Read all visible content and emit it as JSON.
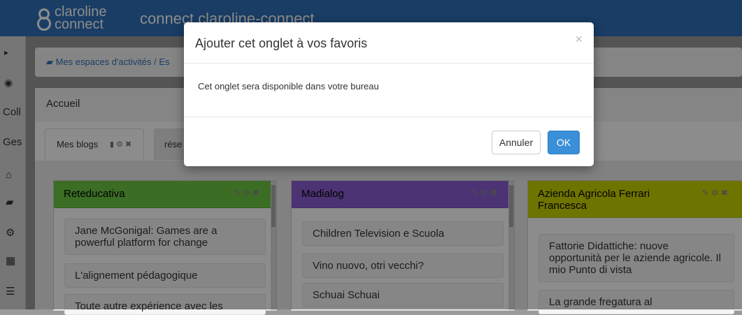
{
  "topbar": {
    "logo_line1": "claroline",
    "logo_line2": "connect",
    "title": "connect claroline-connect",
    "brand_color": "#2f6fb8"
  },
  "sidebar": {
    "items": [
      {
        "icon": "chevron-right-icon",
        "glyph": "▸"
      },
      {
        "icon": "eye-icon",
        "glyph": "◉"
      },
      {
        "label": "Coll"
      },
      {
        "label": "Ges"
      },
      {
        "icon": "home-icon",
        "glyph": "⌂"
      },
      {
        "icon": "folder-icon",
        "glyph": "▰"
      },
      {
        "icon": "cogs-icon",
        "glyph": "⚙"
      },
      {
        "icon": "calendar-icon",
        "glyph": "▦"
      },
      {
        "icon": "list-icon",
        "glyph": "☰"
      }
    ]
  },
  "breadcrumb": {
    "icon": "book-icon",
    "text": "Mes espaces d'activités / Es"
  },
  "panel": {
    "title": "Accueil"
  },
  "tabs": [
    {
      "label": "Mes blogs",
      "icons": "bookmark-icon gear-icon close-icon",
      "glyphs": "▮ ⚙ ✖"
    },
    {
      "label": "rése"
    }
  ],
  "widgets": [
    {
      "title": "Reteducativa",
      "color": "#6cc644",
      "border": "#5aa836",
      "items": [
        "Jane McGonigal: Games are a powerful platform for change",
        "L'alignement pédagogique",
        "Toute autre expérience avec les"
      ]
    },
    {
      "title": "Madialog",
      "color": "#8a5fd4",
      "border": "#7a4fc4",
      "items": [
        "Children Television e Scuola",
        "Vino nuovo, otri vecchi?",
        "Schuai Schuai"
      ]
    },
    {
      "title": "Azienda Agricola Ferrari Francesca",
      "color": "#c8d400",
      "border": "#b0bb00",
      "items": [
        "Fattorie Didattiche: nuove opportunità per le aziende agricole. Il mio Punto di vista",
        "La grande fregatura al"
      ]
    }
  ],
  "widget_icons": "✎ ⚙ ✖",
  "modal": {
    "title": "Ajouter cet onglet à vos favoris",
    "close": "×",
    "body": "Cet onglet sera disponible dans votre bureau",
    "cancel_label": "Annuler",
    "ok_label": "OK"
  }
}
